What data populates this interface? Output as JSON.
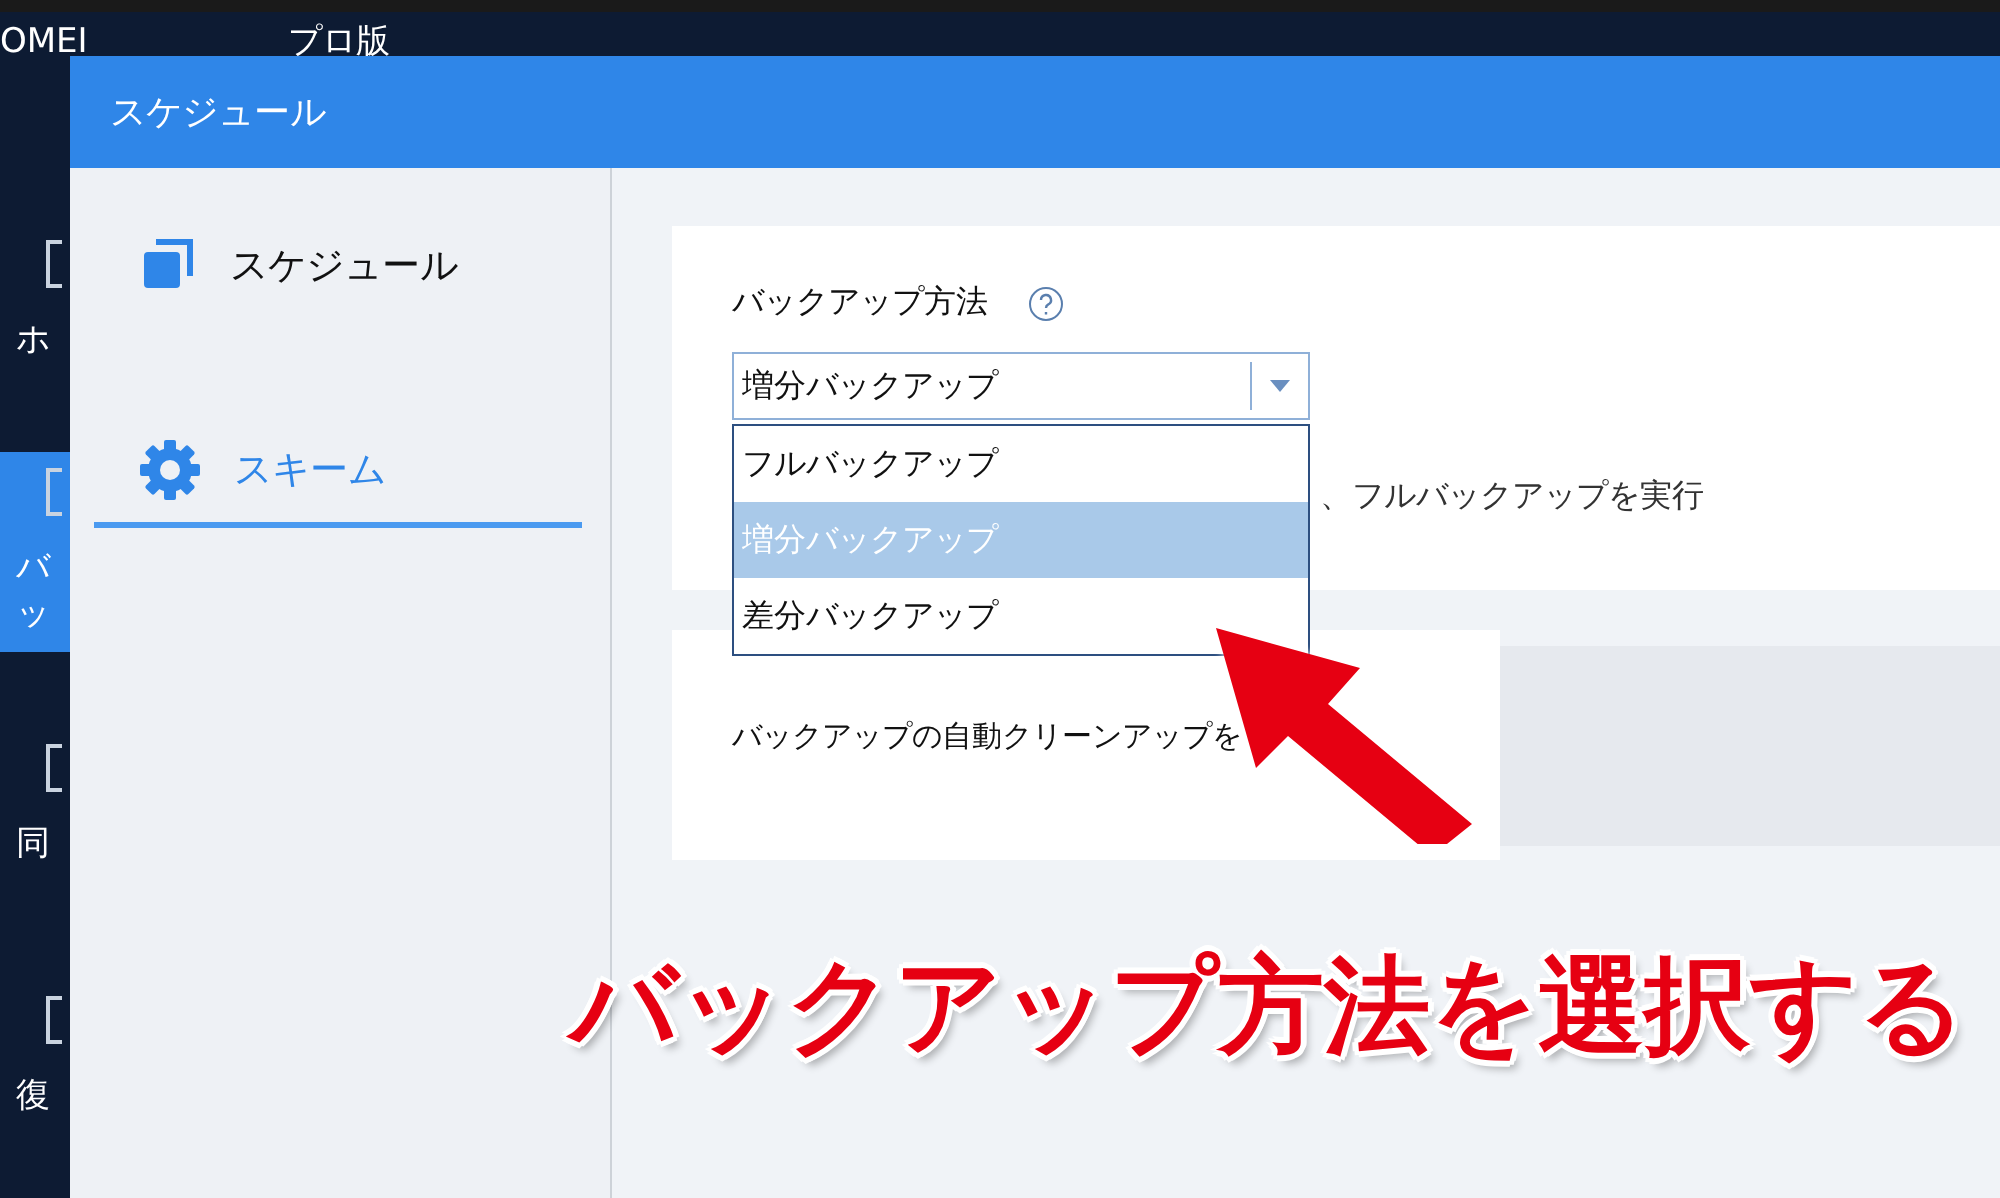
{
  "app_window": {
    "title_parts": [
      "OMEI",
      "プロ版"
    ],
    "nav_items": [
      {
        "label": "ホ",
        "selected": false
      },
      {
        "label": "バッ",
        "selected": true
      },
      {
        "label": "同",
        "selected": false
      },
      {
        "label": "復",
        "selected": false
      }
    ]
  },
  "dialog": {
    "title": "スケジュール",
    "sidebar": {
      "items": [
        {
          "label": "スケジュール",
          "kind": "schedule",
          "selected": false
        },
        {
          "label": "スキーム",
          "kind": "scheme",
          "selected": true
        }
      ]
    },
    "backup_method": {
      "label": "バックアップ方法",
      "value": "増分バックアップ",
      "options": [
        {
          "label": "フルバックアップ",
          "selected": false
        },
        {
          "label": "増分バックアップ",
          "selected": true
        },
        {
          "label": "差分バックアップ",
          "selected": false
        }
      ],
      "description": "、フルバックアップを実行"
    },
    "cleanup": {
      "label": "バックアップの自動クリーンアップを"
    }
  },
  "annotation": {
    "text": "バックアップ方法を選択する"
  }
}
